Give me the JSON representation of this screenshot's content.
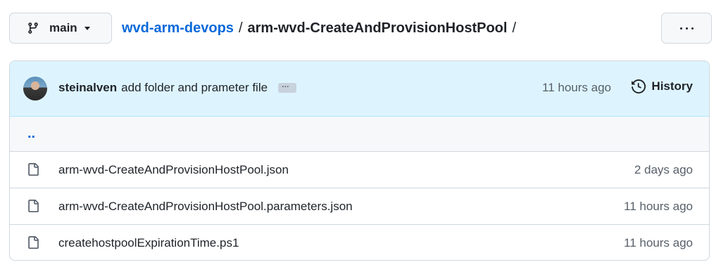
{
  "branch": {
    "label": "main",
    "icon": "git-branch-icon"
  },
  "breadcrumb": {
    "repo": "wvd-arm-devops",
    "separator": "/",
    "folder": "arm-wvd-CreateAndProvisionHostPool",
    "trailing": "/"
  },
  "more_button": {
    "icon": "kebab-horizontal-icon"
  },
  "commit": {
    "author": "steinalven",
    "message": "add folder and prameter file",
    "ellipsis": "…",
    "time": "11 hours ago",
    "history_label": "History"
  },
  "parent_dir": "..",
  "files": [
    {
      "name": "arm-wvd-CreateAndProvisionHostPool.json",
      "age": "2 days ago",
      "icon": "file-icon"
    },
    {
      "name": "arm-wvd-CreateAndProvisionHostPool.parameters.json",
      "age": "11 hours ago",
      "icon": "file-icon"
    },
    {
      "name": "createhostpoolExpirationTime.ps1",
      "age": "11 hours ago",
      "icon": "file-icon"
    }
  ],
  "colors": {
    "link": "#0969da",
    "commit_bg": "#ddf4ff",
    "border": "#d0d7de",
    "muted": "#57606a"
  }
}
